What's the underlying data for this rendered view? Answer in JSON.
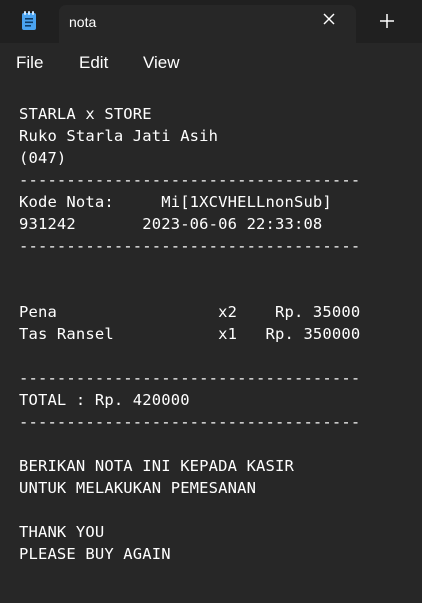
{
  "tab": {
    "title": "nota",
    "app_icon": "notepad-icon",
    "close_icon": "close-icon",
    "new_tab_icon": "plus-icon"
  },
  "menu": {
    "file": "File",
    "edit": "Edit",
    "view": "View"
  },
  "document": {
    "lines": [
      "STARLA x STORE",
      "Ruko Starla Jati Asih",
      "(047)",
      "------------------------------------",
      "Kode Nota:     Mi[1XCVHELLnonSub]",
      "931242       2023-06-06 22:33:08",
      "------------------------------------",
      "",
      "",
      "Pena                 x2    Rp. 35000",
      "Tas Ransel           x1   Rp. 350000",
      "",
      "------------------------------------",
      "TOTAL : Rp. 420000",
      "------------------------------------",
      "",
      "BERIKAN NOTA INI KEPADA KASIR",
      "UNTUK MELAKUKAN PEMESANAN",
      "",
      "THANK YOU",
      "PLEASE BUY AGAIN"
    ]
  },
  "colors": {
    "background": "#272727",
    "tabbar": "#202020",
    "text": "#ffffff",
    "icon_blue": "#4aa3f0"
  }
}
